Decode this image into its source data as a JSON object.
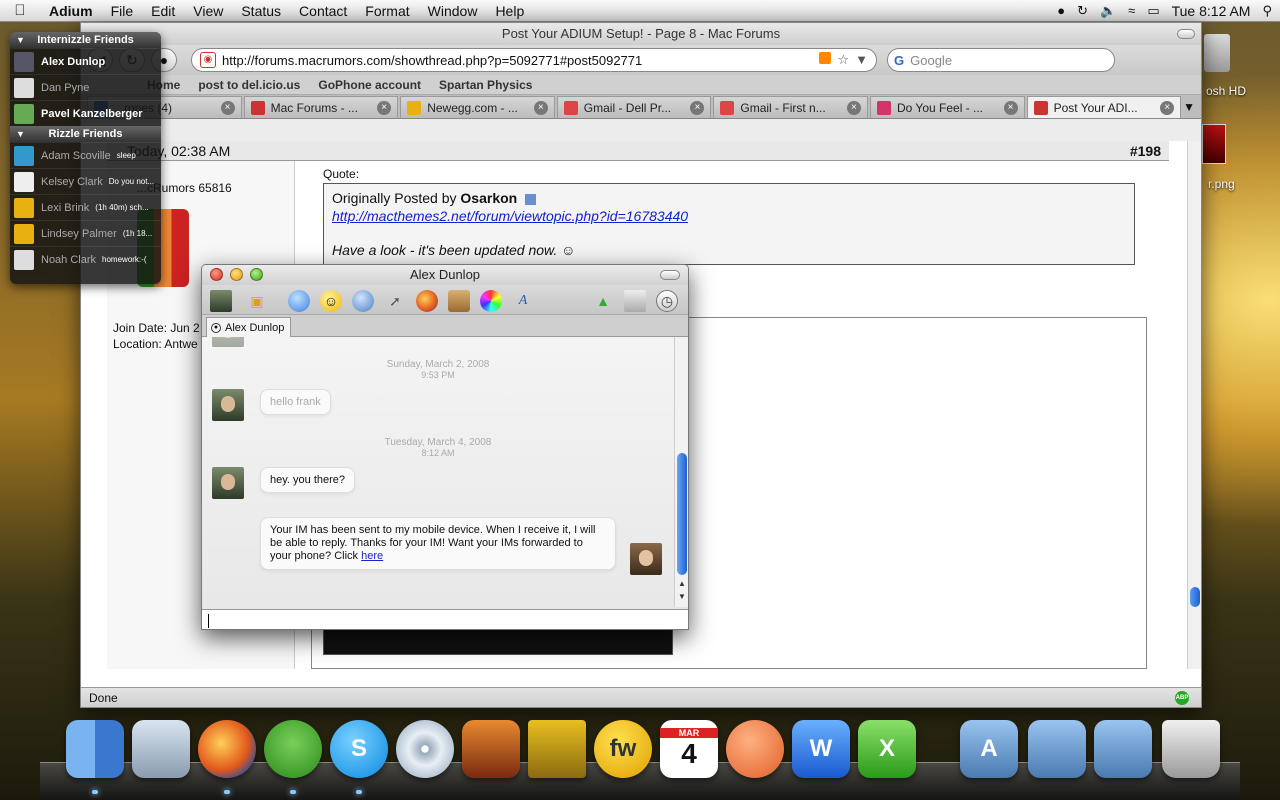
{
  "menubar": {
    "apple_icon": "apple-icon",
    "app_name": "Adium",
    "menus": [
      "File",
      "Edit",
      "View",
      "Status",
      "Contact",
      "Format",
      "Window",
      "Help"
    ],
    "clock": "Tue 8:12 AM"
  },
  "desktop": {
    "hd_label": "osh HD",
    "png_label": "r.png"
  },
  "browser": {
    "title": "Post Your ADIUM Setup! - Page 8 - Mac Forums",
    "url": "http://forums.macrumors.com/showthread.php?p=5092771#post5092771",
    "search_placeholder": "Google",
    "bookmarks": [
      "Home",
      "post to del.icio.us",
      "GoPhone account",
      "Spartan Physics"
    ],
    "tabs": [
      {
        "label": "...ropes (4)",
        "color": "#3a6fd0"
      },
      {
        "label": "Mac Forums - ...",
        "color": "#c33"
      },
      {
        "label": "Newegg.com - ...",
        "color": "#e8b010"
      },
      {
        "label": "Gmail - Dell Pr...",
        "color": "#d44"
      },
      {
        "label": "Gmail - First n...",
        "color": "#d44"
      },
      {
        "label": "Do You Feel - ...",
        "color": "#d3336b"
      },
      {
        "label": "Post Your ADI...",
        "color": "#c33"
      }
    ],
    "status": "Done",
    "adblock": "ABP"
  },
  "post": {
    "date": "Today, 02:38 AM",
    "number_prefix": "#",
    "number": "198",
    "posts_count": "...cRumors 65816",
    "join_date": "Join Date: Jun 2",
    "location": "Location: Antwe",
    "quote_label": "Quote:",
    "quote_prefix": "Originally Posted by ",
    "quote_author": "Osarkon",
    "quote_link": "http://macthemes2.net/forum/viewtopic.php?id=16783440",
    "quote_message": "Have a look - it's been updated now. ☺"
  },
  "contacts": {
    "groups": [
      {
        "name": "Internizzle Friends",
        "buddies": [
          {
            "name": "Alex Dunlop",
            "status": "",
            "state": "online",
            "color": "#556"
          },
          {
            "name": "Dan Pyne",
            "status": "",
            "state": "away",
            "color": "#ddd"
          },
          {
            "name": "Pavel Kanzelberger",
            "status": "",
            "state": "online",
            "color": "#6a5"
          }
        ]
      },
      {
        "name": "Rizzle Friends",
        "buddies": [
          {
            "name": "Adam Scoville",
            "status": "sleep",
            "state": "away",
            "color": "#39c"
          },
          {
            "name": "Kelsey Clark",
            "status": "Do you not...",
            "state": "away",
            "color": "#eee"
          },
          {
            "name": "Lexi Brink",
            "status": "(1h 40m) sch...",
            "state": "away",
            "color": "#e8b010"
          },
          {
            "name": "Lindsey Palmer",
            "status": "(1h 18...",
            "state": "away",
            "color": "#e8b010"
          },
          {
            "name": "Noah Clark",
            "status": "homework:-(",
            "state": "away",
            "color": "#ddd"
          }
        ]
      }
    ]
  },
  "chat": {
    "title": "Alex Dunlop",
    "tab_label": "Alex Dunlop",
    "messages": [
      {
        "day": "Sunday, March 2, 2008",
        "time": "9:53 PM",
        "text": "hello frank"
      },
      {
        "day": "Tuesday, March 4, 2008",
        "time": "8:12 AM",
        "text": "hey. you there?"
      }
    ],
    "auto_reply": "Your IM has been sent to my mobile device. When I receive it, I will be able to reply. Thanks for your IM! Want your IMs forwarded to your phone? Click ",
    "auto_reply_link": "here"
  },
  "dock": {
    "calendar_month": "MAR",
    "calendar_day": "4"
  }
}
